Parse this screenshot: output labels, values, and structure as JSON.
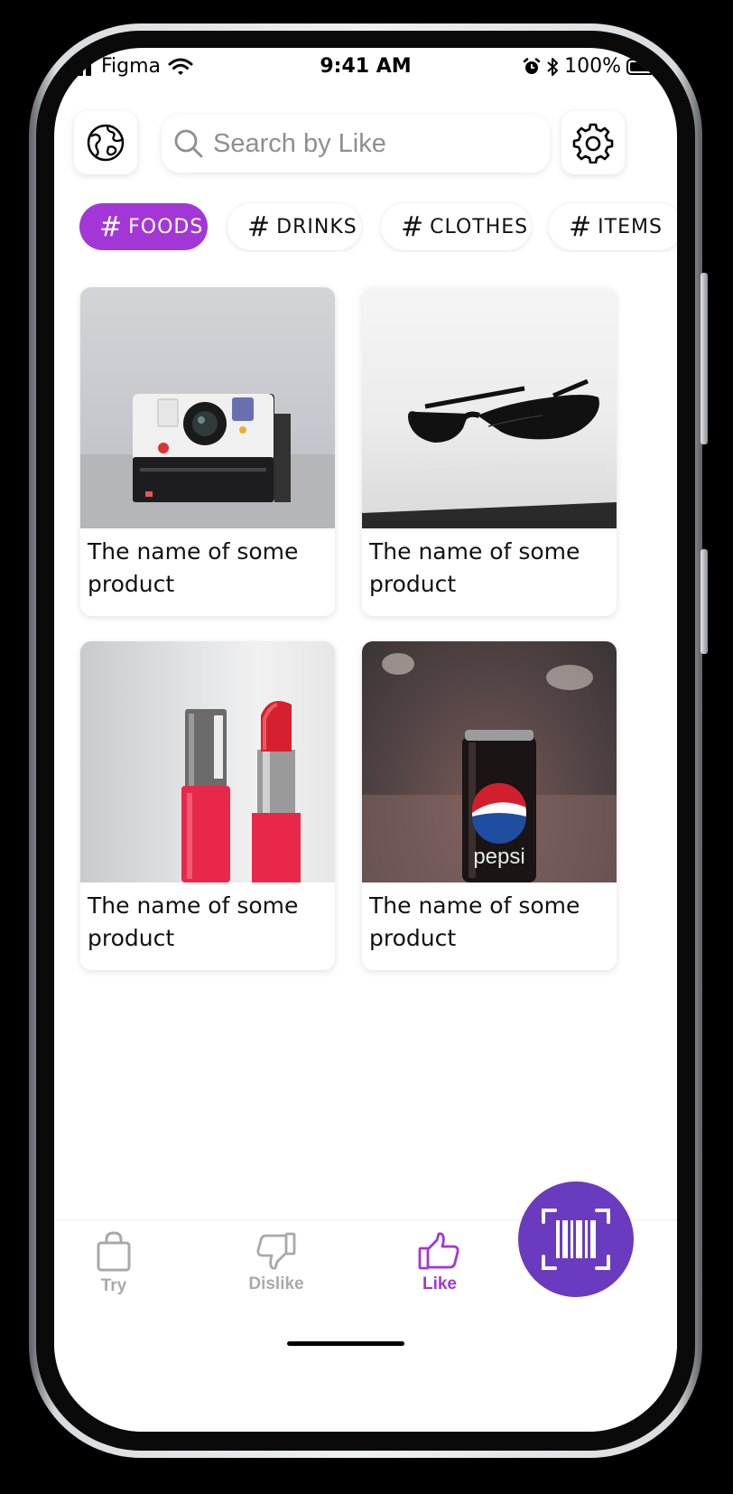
{
  "status": {
    "carrier": "Figma",
    "time": "9:41 AM",
    "battery": "100%"
  },
  "header": {
    "search_placeholder": "Search by Like"
  },
  "categories": [
    {
      "hash": "#",
      "label": "FOODS",
      "active": true
    },
    {
      "hash": "#",
      "label": "DRINKS",
      "active": false
    },
    {
      "hash": "#",
      "label": "CLOTHES",
      "active": false
    },
    {
      "hash": "#",
      "label": "ITEMS",
      "active": false
    }
  ],
  "products": [
    {
      "name": "The name of some product",
      "image": "instant-camera"
    },
    {
      "name": "The name of some product",
      "image": "sunglasses"
    },
    {
      "name": "The name of some product",
      "image": "lipstick-and-nail-polish"
    },
    {
      "name": "The name of some product",
      "image": "soda-can"
    }
  ],
  "tabbar": {
    "try_label": "Try",
    "dislike_label": "Dislike",
    "like_label": "Like",
    "active": "Like"
  },
  "colors": {
    "accent": "#a336d6",
    "fab": "#6a3bbf",
    "inactive": "#a9a9ab"
  },
  "icons": [
    "globe-icon",
    "search-icon",
    "gear-icon",
    "shopping-bag-icon",
    "thumbs-down-icon",
    "thumbs-up-icon",
    "barcode-scan-icon"
  ]
}
